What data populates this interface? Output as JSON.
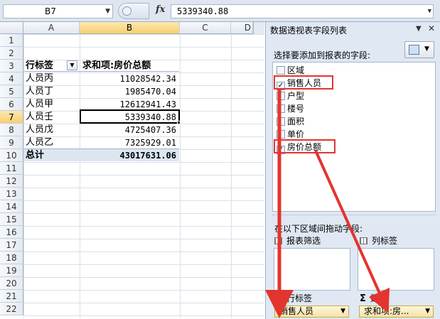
{
  "formula_bar": {
    "name_box": "B7",
    "fx_label": "fx",
    "formula": "5339340.88"
  },
  "sheet": {
    "columns": [
      "A",
      "B",
      "C",
      "D"
    ],
    "rows": [
      "1",
      "2",
      "3",
      "4",
      "5",
      "6",
      "7",
      "8",
      "9",
      "10",
      "11",
      "12",
      "13",
      "14",
      "15",
      "16",
      "17",
      "18",
      "19",
      "20",
      "21",
      "22"
    ],
    "pivot": {
      "row_label_header": "行标签",
      "value_header": "求和项:房价总额",
      "items": [
        {
          "name": "人员丙",
          "value": "11028542.34"
        },
        {
          "name": "人员丁",
          "value": "1985470.04"
        },
        {
          "name": "人员甲",
          "value": "12612941.43"
        },
        {
          "name": "人员壬",
          "value": "5339340.88"
        },
        {
          "name": "人员戊",
          "value": "4725407.36"
        },
        {
          "name": "人员乙",
          "value": "7325929.01"
        }
      ],
      "total_label": "总计",
      "total_value": "43017631.06"
    }
  },
  "pane": {
    "title": "数据透视表字段列表",
    "choose_label": "选择要添加到报表的字段:",
    "fields": [
      {
        "label": "区域",
        "checked": false
      },
      {
        "label": "销售人员",
        "checked": true
      },
      {
        "label": "户型",
        "checked": false
      },
      {
        "label": "楼号",
        "checked": false
      },
      {
        "label": "面积",
        "checked": false
      },
      {
        "label": "单价",
        "checked": false
      },
      {
        "label": "房价总额",
        "checked": true
      }
    ],
    "drag_label": "在以下区域间拖动字段:",
    "areas": {
      "report_filter": "报表筛选",
      "column_labels": "列标签",
      "row_labels": "行标签",
      "values": "数值"
    },
    "row_field": "销售人员",
    "value_field": "求和项:房...",
    "check_mark": "✓",
    "dropdown_glyph": "▼",
    "close_glyph": "✕"
  },
  "colors": {
    "highlight": "#e3342f",
    "pane_bg": "#dfe8f3",
    "total_bg": "#dce6f1"
  }
}
